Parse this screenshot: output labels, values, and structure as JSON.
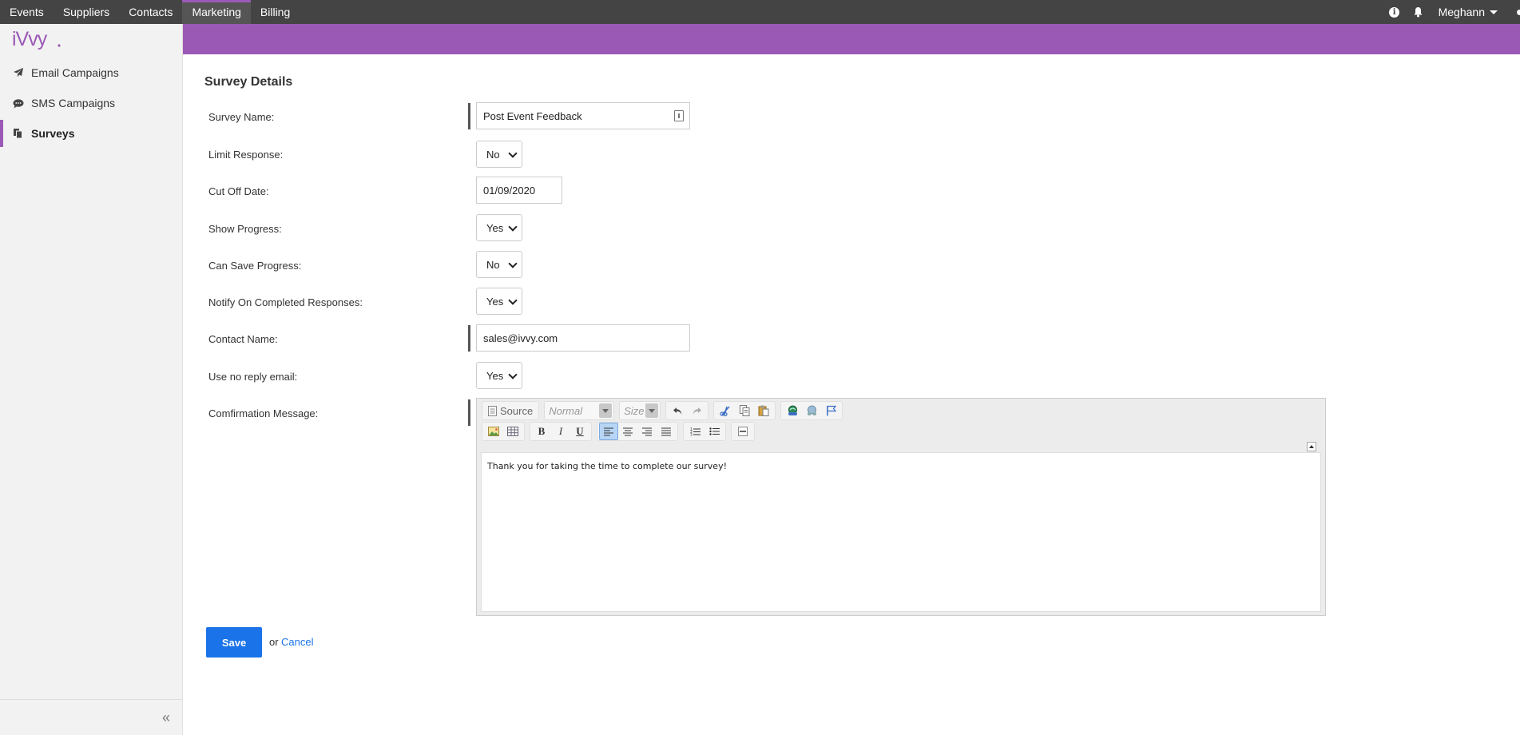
{
  "topnav": {
    "items": [
      {
        "label": "Events",
        "active": false
      },
      {
        "label": "Suppliers",
        "active": false
      },
      {
        "label": "Contacts",
        "active": false
      },
      {
        "label": "Marketing",
        "active": true
      },
      {
        "label": "Billing",
        "active": false
      }
    ],
    "user_name": "Meghann",
    "icons": [
      "info-icon",
      "bell-icon",
      "caret-down-icon"
    ]
  },
  "brand": {
    "logo_text": "iVvy",
    "accent_color": "#9b59b6",
    "primary_button_color": "#1a73e8"
  },
  "sidebar": {
    "items": [
      {
        "label": "Email Campaigns",
        "icon": "paper-plane-icon",
        "active": false
      },
      {
        "label": "SMS Campaigns",
        "icon": "chat-bubble-icon",
        "active": false
      },
      {
        "label": "Surveys",
        "icon": "copy-document-icon",
        "active": true
      }
    ],
    "collapse_label": "«"
  },
  "form": {
    "title": "Survey Details",
    "survey_name": {
      "label": "Survey Name:",
      "value": "Post Event Feedback"
    },
    "limit_response": {
      "label": "Limit Response:",
      "value": "No"
    },
    "cut_off_date": {
      "label": "Cut Off Date:",
      "value": "01/09/2020"
    },
    "show_progress": {
      "label": "Show Progress:",
      "value": "Yes"
    },
    "can_save_progress": {
      "label": "Can Save Progress:",
      "value": "No"
    },
    "notify_on_completed": {
      "label": "Notify On Completed Responses:",
      "value": "Yes"
    },
    "contact_name": {
      "label": "Contact Name:",
      "value": "sales@ivvy.com"
    },
    "use_no_reply": {
      "label": "Use no reply email:",
      "value": "Yes"
    },
    "confirmation_message": {
      "label": "Comfirmation Message:",
      "toolbar": {
        "source_label": "Source",
        "format_placeholder": "Normal",
        "size_placeholder": "Size"
      },
      "body": "Thank you for taking the time to complete our survey!"
    },
    "save_label": "Save",
    "or_text": "or",
    "cancel_label": "Cancel"
  }
}
